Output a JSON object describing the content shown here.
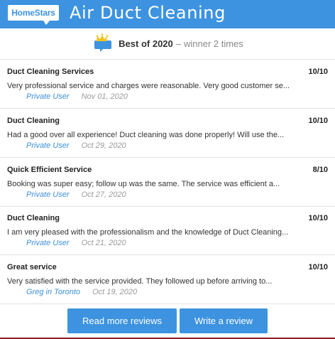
{
  "header": {
    "logo_text": "HomeStars",
    "title": "Air Duct Cleaning"
  },
  "award": {
    "best_label": "Best of 2020",
    "separator": "–",
    "winner_text": "winner 2 times"
  },
  "reviews": [
    {
      "title": "Duct Cleaning Services",
      "score": "10/10",
      "text": "Very professional service and charges were reasonable. Very good customer se...",
      "author": "Private User",
      "date": "Nov 01, 2020"
    },
    {
      "title": "Duct Cleaning",
      "score": "10/10",
      "text": "Had a good over all experience! Duct cleaning was done properly! Will use the...",
      "author": "Private User",
      "date": "Oct 29, 2020"
    },
    {
      "title": "Quick Efficient Service",
      "score": "8/10",
      "text": "Booking was super easy; follow up was the same. The service was efficient a...",
      "author": "Private User",
      "date": "Oct 27, 2020"
    },
    {
      "title": "Duct Cleaning",
      "score": "10/10",
      "text": "I am very pleased with the professionalism and the knowledge of Duct Cleaning...",
      "author": "Private User",
      "date": "Oct 21, 2020"
    },
    {
      "title": "Great service",
      "score": "10/10",
      "text": "Very satisfied with the service provided. They followed up before arriving to...",
      "author": "Greg in Toronto",
      "date": "Oct 19, 2020"
    }
  ],
  "actions": {
    "read_more_label": "Read more reviews",
    "write_review_label": "Write a review"
  },
  "colors": {
    "brand_blue": "#3d93e0",
    "author_link": "#3d8fd8",
    "bottom_bar": "#8b1d1d"
  },
  "icons": {
    "award": "crown-speech-bubble-icon"
  }
}
